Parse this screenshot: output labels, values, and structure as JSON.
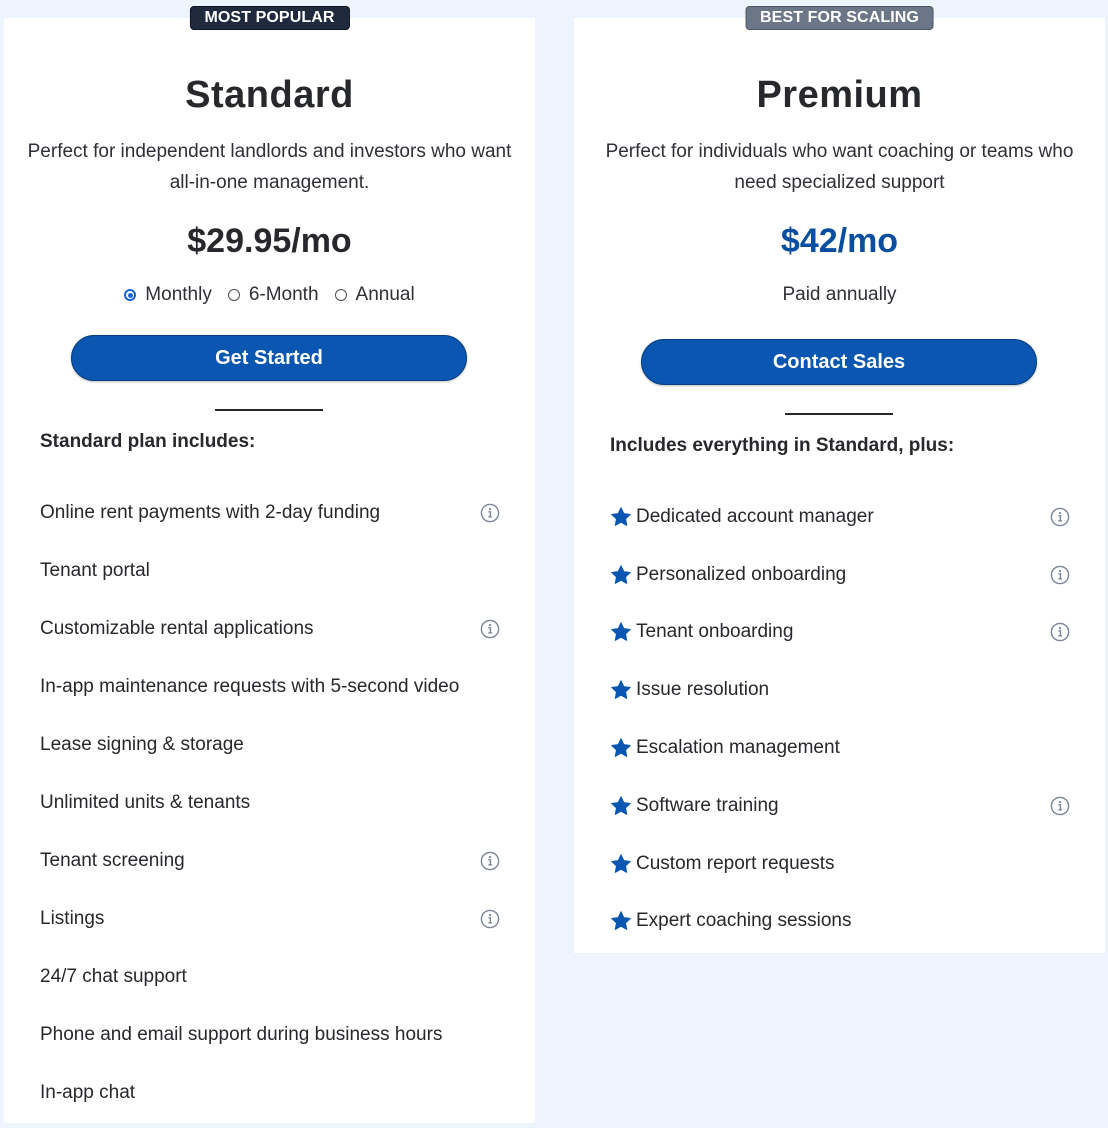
{
  "colors": {
    "page_bg": "#eef4fd",
    "card_bg": "#ffffff",
    "primary_button": "#0a56b0",
    "price_blue": "#0a4ea0",
    "radio_selected": "#1a63d6",
    "star": "#0a56b0",
    "badge_dark": "#1f2b3d",
    "badge_grey": "#6b7687"
  },
  "standard": {
    "badge": "MOST POPULAR",
    "name": "Standard",
    "description": "Perfect for independent landlords and investors who want all-in-one management.",
    "price": "$29.95/mo",
    "billing_options": [
      {
        "label": "Monthly",
        "selected": true
      },
      {
        "label": "6-Month",
        "selected": false
      },
      {
        "label": "Annual",
        "selected": false
      }
    ],
    "cta_label": "Get Started",
    "includes_heading": "Standard plan includes:",
    "features": [
      {
        "label": "Online rent payments with 2-day funding",
        "info": true
      },
      {
        "label": "Tenant portal",
        "info": false
      },
      {
        "label": "Customizable rental applications",
        "info": true
      },
      {
        "label": "In-app maintenance requests with 5-second video",
        "info": false
      },
      {
        "label": "Lease signing & storage",
        "info": false
      },
      {
        "label": "Unlimited units & tenants",
        "info": false
      },
      {
        "label": "Tenant screening",
        "info": true
      },
      {
        "label": "Listings",
        "info": true
      },
      {
        "label": "24/7 chat support",
        "info": false
      },
      {
        "label": "Phone and email support during business hours",
        "info": false
      },
      {
        "label": "In-app chat",
        "info": false
      }
    ]
  },
  "premium": {
    "badge": "BEST FOR SCALING",
    "name": "Premium",
    "description": "Perfect for individuals who want coaching or teams who need specialized support",
    "price": "$42/mo",
    "billing_note": "Paid annually",
    "cta_label": "Contact Sales",
    "includes_heading": "Includes everything in Standard, plus:",
    "features": [
      {
        "label": "Dedicated account manager",
        "info": true,
        "icon": "star-icon"
      },
      {
        "label": "Personalized onboarding",
        "info": true,
        "icon": "star-icon"
      },
      {
        "label": "Tenant onboarding",
        "info": true,
        "icon": "star-icon"
      },
      {
        "label": "Issue resolution",
        "info": false,
        "icon": "star-icon"
      },
      {
        "label": "Escalation management",
        "info": false,
        "icon": "star-icon"
      },
      {
        "label": "Software training",
        "info": true,
        "icon": "star-icon"
      },
      {
        "label": "Custom report requests",
        "info": false,
        "icon": "star-icon"
      },
      {
        "label": "Expert coaching sessions",
        "info": false,
        "icon": "star-icon"
      }
    ]
  }
}
